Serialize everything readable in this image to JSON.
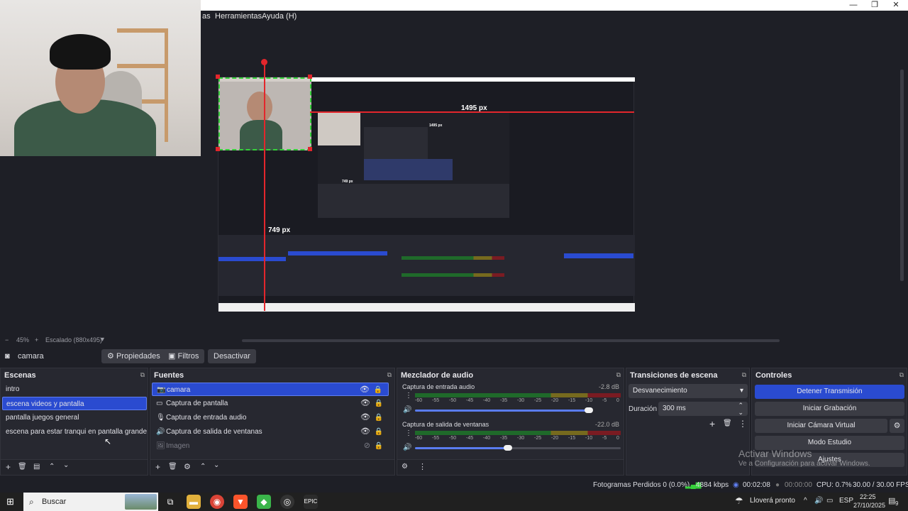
{
  "window": {
    "minimize": "—",
    "maximize": "❐",
    "close": "✕"
  },
  "menu": {
    "items": [
      "as",
      "Herramientas",
      "Ayuda (H)"
    ]
  },
  "preview": {
    "width_label": "1495 px",
    "height_label": "749 px",
    "nested_width_label": "1495 px",
    "nested_height_label": "749 px"
  },
  "zoom": {
    "minus": "−",
    "value": "45%",
    "plus": "+",
    "mode": "Escalado (880x495)"
  },
  "source_bar": {
    "source_name": "camara",
    "properties": "Propiedades",
    "filters": "Filtros",
    "deactivate": "Desactivar"
  },
  "scenes": {
    "title": "Escenas",
    "items": [
      {
        "label": "intro",
        "selected": false
      },
      {
        "label": "escena videos y pantalla",
        "selected": true
      },
      {
        "label": "pantalla juegos general",
        "selected": false
      },
      {
        "label": "escena para estar tranqui en pantalla grande",
        "selected": false
      }
    ]
  },
  "sources": {
    "title": "Fuentes",
    "items": [
      {
        "label": "camara",
        "icon": "camera-icon",
        "glyph": "📷",
        "selected": true,
        "visible": true
      },
      {
        "label": "Captura de pantalla",
        "icon": "monitor-icon",
        "glyph": "▭",
        "selected": false,
        "visible": true
      },
      {
        "label": "Captura de entrada audio",
        "icon": "microphone-icon",
        "glyph": "🎙",
        "selected": false,
        "visible": true
      },
      {
        "label": "Captura de salida de ventanas",
        "icon": "speaker-icon",
        "glyph": "🔊",
        "selected": false,
        "visible": true
      },
      {
        "label": "Imagen",
        "icon": "image-icon",
        "glyph": "🖼",
        "selected": false,
        "visible": false
      }
    ]
  },
  "mixer": {
    "title": "Mezclador de audio",
    "channels": [
      {
        "name": "Captura de entrada audio",
        "db": "-2.8 dB",
        "volume": 0.96
      },
      {
        "name": "Captura de salida de ventanas",
        "db": "-22.0 dB",
        "volume": 0.5
      }
    ],
    "scale": [
      "-60",
      "-55",
      "-50",
      "-45",
      "-40",
      "-35",
      "-30",
      "-25",
      "-20",
      "-15",
      "-10",
      "-5",
      "0"
    ]
  },
  "transitions": {
    "title": "Transiciones de escena",
    "selected": "Desvanecimiento",
    "duration_label": "Duración",
    "duration_value": "300 ms"
  },
  "controls": {
    "title": "Controles",
    "stop_stream": "Detener Transmisión",
    "start_recording": "Iniciar Grabación",
    "start_virtual_cam": "Iniciar Cámara Virtual",
    "studio_mode": "Modo Estudio",
    "settings": "Ajustes"
  },
  "activation": {
    "title": "Activar Windows",
    "subtitle": "Ve a Configuración para activar Windows."
  },
  "status": {
    "dropped_frames": "Fotogramas Perdidos 0 (0.0%)",
    "bitrate": "4884 kbps",
    "stream_time": "00:02:08",
    "rec_time": "00:00:00",
    "cpu": "CPU: 0.7%",
    "fps": "30.00 / 30.00 FPS"
  },
  "taskbar": {
    "search_placeholder": "Buscar",
    "weather": "Lloverá pronto",
    "language": "ESP",
    "time": "22:25",
    "date": "27/10/2025",
    "notifications": "9"
  },
  "colors": {
    "accent": "#2a4bd0",
    "selection_red": "#e3262c",
    "dock_bg": "#272830",
    "app_bg": "#1e1f26"
  }
}
